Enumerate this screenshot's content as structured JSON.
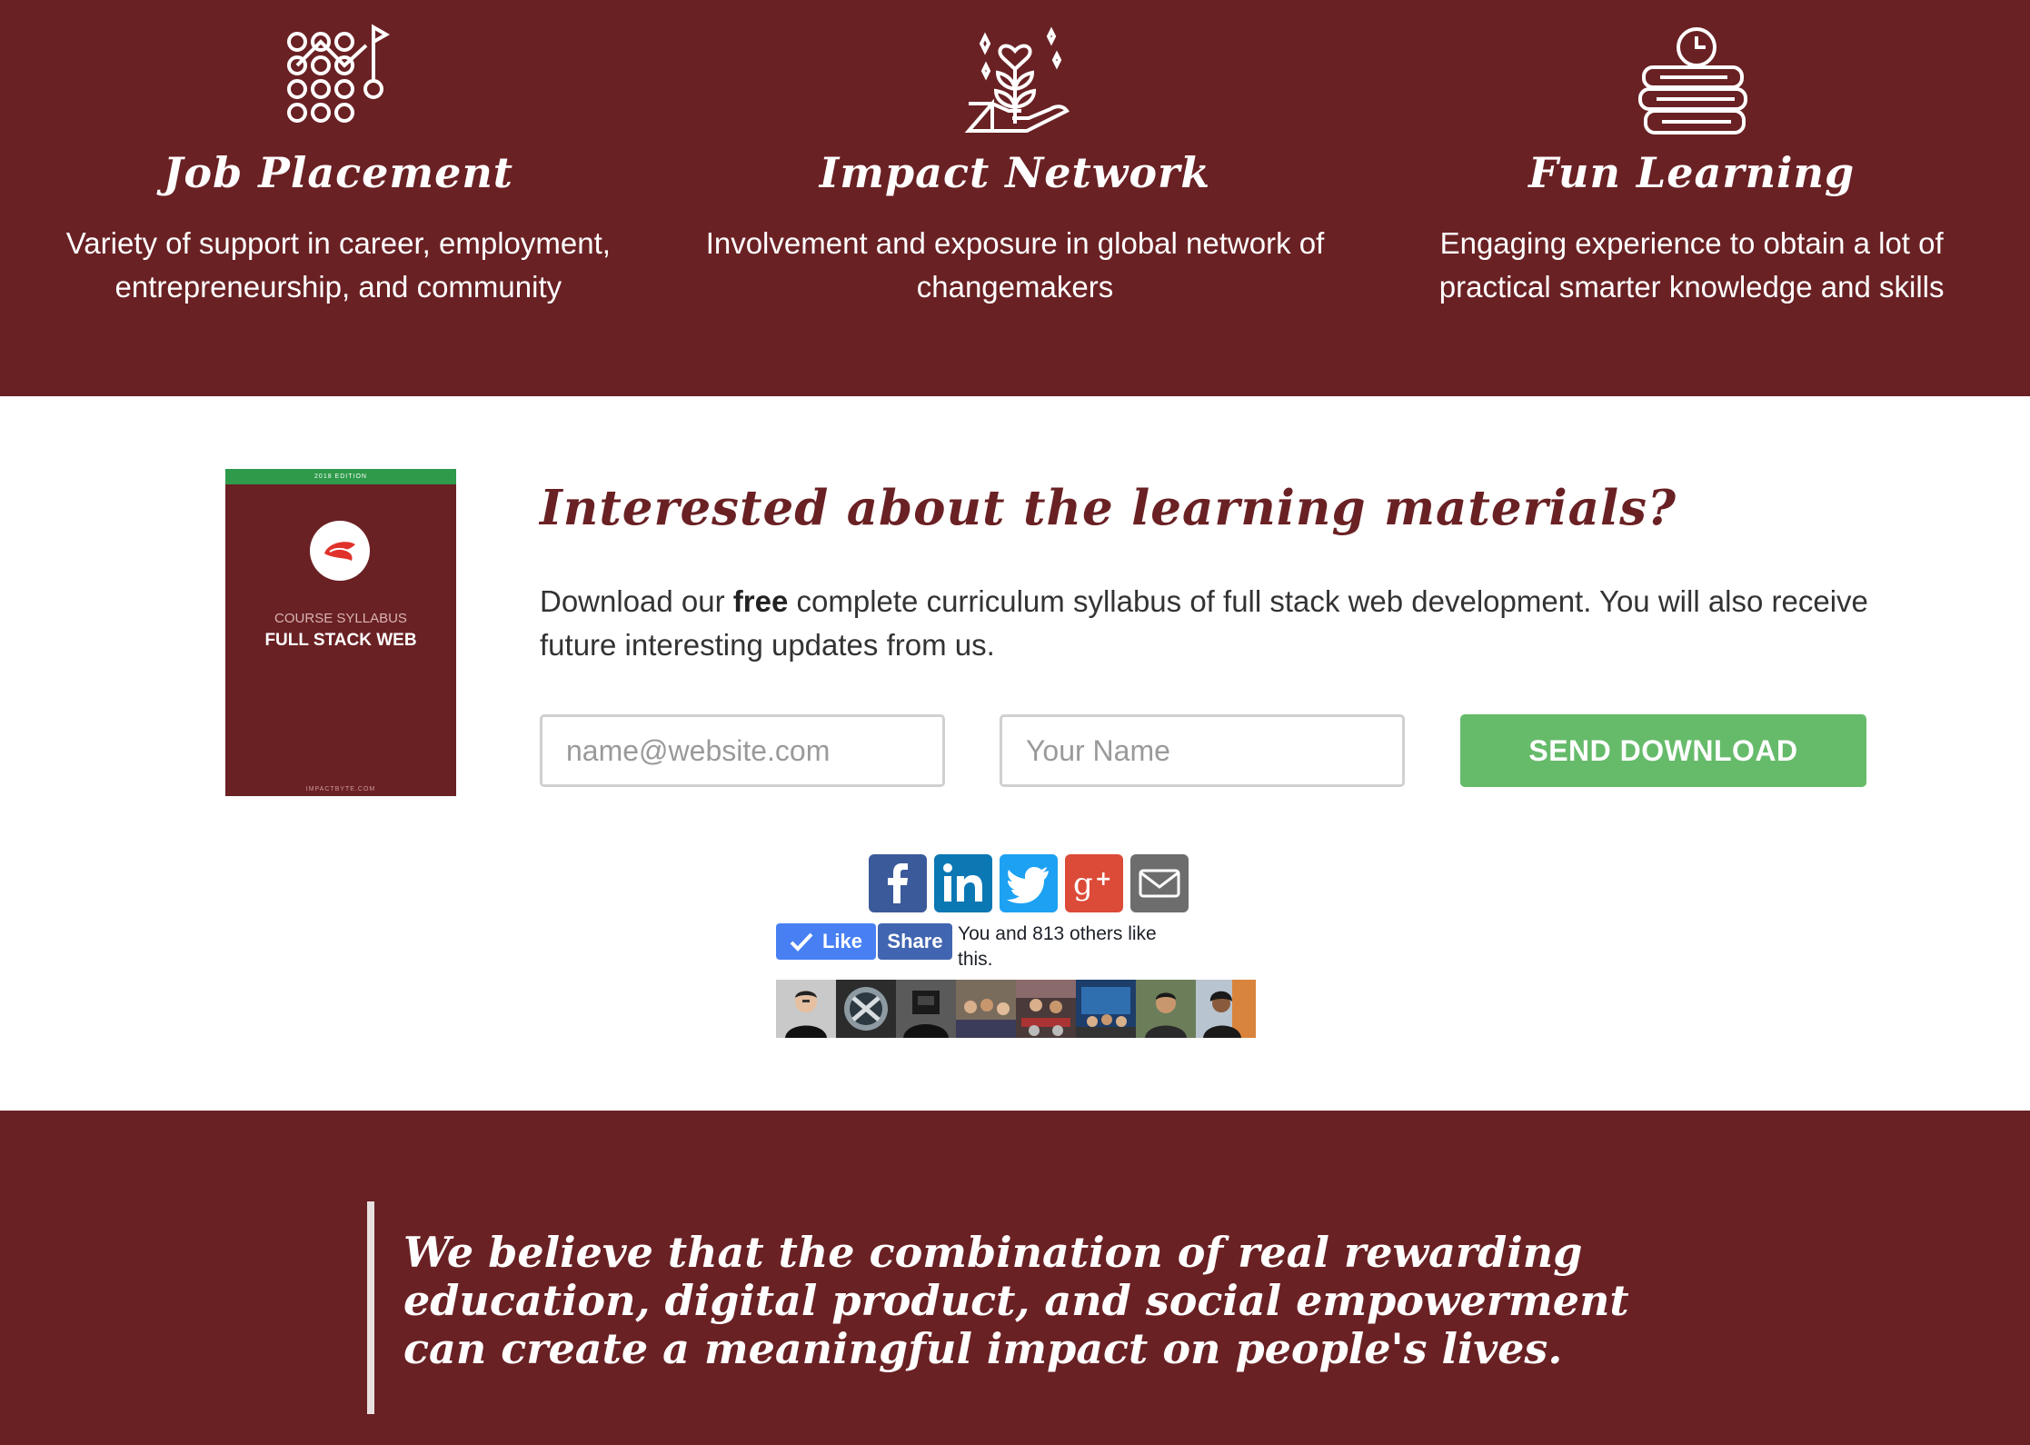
{
  "features": [
    {
      "icon": "strategy-board-icon",
      "title": "Job Placement",
      "text": "Variety of support in career, employment, entrepreneurship, and community"
    },
    {
      "icon": "hand-plant-heart-icon",
      "title": "Impact Network",
      "text": "Involvement and exposure in global network of changemakers"
    },
    {
      "icon": "books-clock-icon",
      "title": "Fun Learning",
      "text": "Engaging experience to obtain a lot of practical smarter knowledge and skills"
    }
  ],
  "book": {
    "edition": "2018 EDITION",
    "course": "COURSE SYLLABUS",
    "title": "FULL STACK WEB",
    "site": "IMPACTBYTE.COM"
  },
  "download": {
    "title": "Interested about the learning materials?",
    "text_before": "Download our ",
    "text_bold": "free",
    "text_after": " complete curriculum syllabus of full stack web development. You will also receive future interesting updates from us.",
    "email_placeholder": "name@website.com",
    "name_placeholder": "Your Name",
    "button_label": "SEND DOWNLOAD"
  },
  "share": {
    "icons": [
      "facebook-icon",
      "linkedin-icon",
      "twitter-icon",
      "google-plus-icon",
      "email-icon"
    ]
  },
  "facebook": {
    "like_label": "Like",
    "share_label": "Share",
    "like_text": "You and 813 others like this."
  },
  "quote": {
    "text": "We believe that the combination of real rewarding education, digital product, and social empowerment can create a meaningful impact on people's lives."
  },
  "colors": {
    "brand": "#6a2124",
    "send": "#66bb6a",
    "facebook": "#3b5a9a",
    "linkedin": "#0b78b4",
    "twitter": "#1da1f2",
    "google_plus": "#dc4a38",
    "email": "#6d6d6d"
  }
}
